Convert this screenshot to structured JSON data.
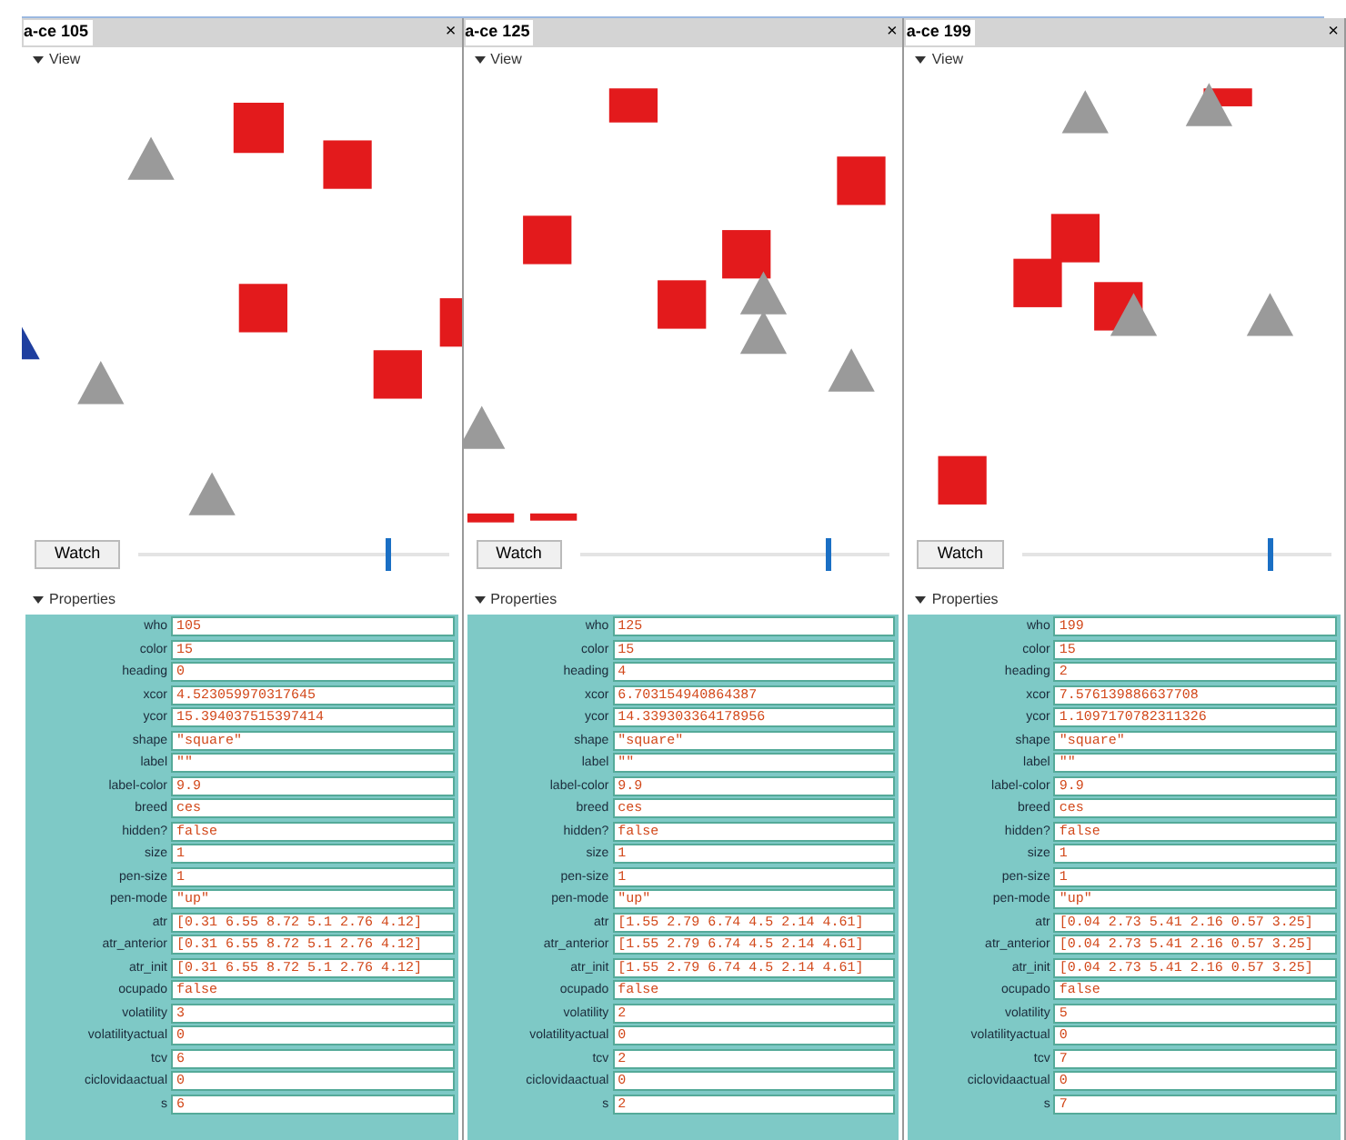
{
  "monitors": [
    {
      "title": "a-ce 105",
      "close": "×",
      "view_label": "View",
      "watch_button": "Watch",
      "slider": {
        "level": 0.8
      },
      "properties_label": "Properties",
      "properties": [
        {
          "name": "who",
          "value": "105"
        },
        {
          "name": "color",
          "value": "15"
        },
        {
          "name": "heading",
          "value": "0"
        },
        {
          "name": "xcor",
          "value": "4.523059970317645"
        },
        {
          "name": "ycor",
          "value": "15.394037515397414"
        },
        {
          "name": "shape",
          "value": "\"square\""
        },
        {
          "name": "label",
          "value": "\"\""
        },
        {
          "name": "label-color",
          "value": "9.9"
        },
        {
          "name": "breed",
          "value": "ces"
        },
        {
          "name": "hidden?",
          "value": "false"
        },
        {
          "name": "size",
          "value": "1"
        },
        {
          "name": "pen-size",
          "value": "1"
        },
        {
          "name": "pen-mode",
          "value": "\"up\""
        },
        {
          "name": "atr",
          "value": "[0.31 6.55 8.72 5.1 2.76 4.12]"
        },
        {
          "name": "atr_anterior",
          "value": "[0.31 6.55 8.72 5.1 2.76 4.12]"
        },
        {
          "name": "atr_init",
          "value": "[0.31 6.55 8.72 5.1 2.76 4.12]"
        },
        {
          "name": "ocupado",
          "value": "false"
        },
        {
          "name": "volatility",
          "value": "3"
        },
        {
          "name": "volatilityactual",
          "value": "0"
        },
        {
          "name": "tcv",
          "value": "6"
        },
        {
          "name": "ciclovidaactual",
          "value": "0"
        },
        {
          "name": "s",
          "value": "6"
        }
      ]
    },
    {
      "title": "a-ce 125",
      "close": "×",
      "view_label": "View",
      "watch_button": "Watch",
      "slider": {
        "level": 0.8
      },
      "properties_label": "Properties",
      "properties": [
        {
          "name": "who",
          "value": "125"
        },
        {
          "name": "color",
          "value": "15"
        },
        {
          "name": "heading",
          "value": "4"
        },
        {
          "name": "xcor",
          "value": "6.703154940864387"
        },
        {
          "name": "ycor",
          "value": "14.339303364178956"
        },
        {
          "name": "shape",
          "value": "\"square\""
        },
        {
          "name": "label",
          "value": "\"\""
        },
        {
          "name": "label-color",
          "value": "9.9"
        },
        {
          "name": "breed",
          "value": "ces"
        },
        {
          "name": "hidden?",
          "value": "false"
        },
        {
          "name": "size",
          "value": "1"
        },
        {
          "name": "pen-size",
          "value": "1"
        },
        {
          "name": "pen-mode",
          "value": "\"up\""
        },
        {
          "name": "atr",
          "value": "[1.55 2.79 6.74 4.5 2.14 4.61]"
        },
        {
          "name": "atr_anterior",
          "value": "[1.55 2.79 6.74 4.5 2.14 4.61]"
        },
        {
          "name": "atr_init",
          "value": "[1.55 2.79 6.74 4.5 2.14 4.61]"
        },
        {
          "name": "ocupado",
          "value": "false"
        },
        {
          "name": "volatility",
          "value": "2"
        },
        {
          "name": "volatilityactual",
          "value": "0"
        },
        {
          "name": "tcv",
          "value": "2"
        },
        {
          "name": "ciclovidaactual",
          "value": "0"
        },
        {
          "name": "s",
          "value": "2"
        }
      ]
    },
    {
      "title": "a-ce 199",
      "close": "×",
      "view_label": "View",
      "watch_button": "Watch",
      "slider": {
        "level": 0.8
      },
      "properties_label": "Properties",
      "properties": [
        {
          "name": "who",
          "value": "199"
        },
        {
          "name": "color",
          "value": "15"
        },
        {
          "name": "heading",
          "value": "2"
        },
        {
          "name": "xcor",
          "value": "7.576139886637708"
        },
        {
          "name": "ycor",
          "value": "1.1097170782311326"
        },
        {
          "name": "shape",
          "value": "\"square\""
        },
        {
          "name": "label",
          "value": "\"\""
        },
        {
          "name": "label-color",
          "value": "9.9"
        },
        {
          "name": "breed",
          "value": "ces"
        },
        {
          "name": "hidden?",
          "value": "false"
        },
        {
          "name": "size",
          "value": "1"
        },
        {
          "name": "pen-size",
          "value": "1"
        },
        {
          "name": "pen-mode",
          "value": "\"up\""
        },
        {
          "name": "atr",
          "value": "[0.04 2.73 5.41 2.16 0.57 3.25]"
        },
        {
          "name": "atr_anterior",
          "value": "[0.04 2.73 5.41 2.16 0.57 3.25]"
        },
        {
          "name": "atr_init",
          "value": "[0.04 2.73 5.41 2.16 0.57 3.25]"
        },
        {
          "name": "ocupado",
          "value": "false"
        },
        {
          "name": "volatility",
          "value": "5"
        },
        {
          "name": "volatilityactual",
          "value": "0"
        },
        {
          "name": "tcv",
          "value": "7"
        },
        {
          "name": "ciclovidaactual",
          "value": "0"
        },
        {
          "name": "s",
          "value": "7"
        }
      ]
    }
  ]
}
